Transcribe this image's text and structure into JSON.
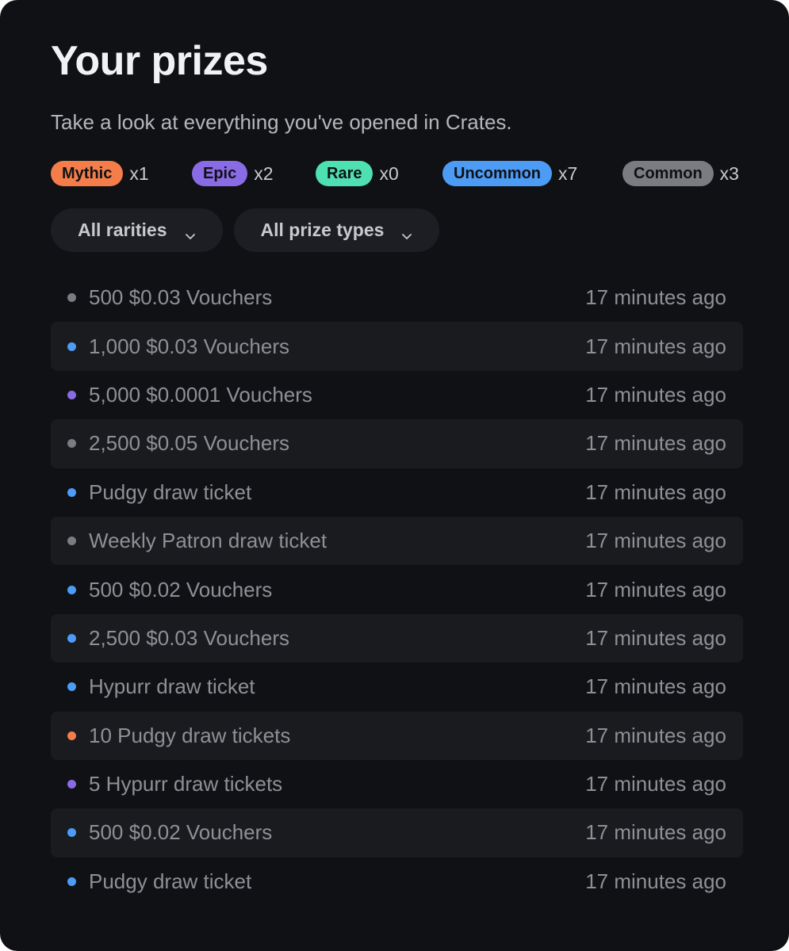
{
  "header": {
    "title": "Your prizes",
    "subtitle": "Take a look at everything you've opened in Crates."
  },
  "rarities": [
    {
      "label": "Mythic",
      "count": "x1",
      "color": "#f47d4a"
    },
    {
      "label": "Epic",
      "count": "x2",
      "color": "#8a6be6"
    },
    {
      "label": "Rare",
      "count": "x0",
      "color": "#4ee0b0"
    },
    {
      "label": "Uncommon",
      "count": "x7",
      "color": "#4c9bf5"
    },
    {
      "label": "Common",
      "count": "x3",
      "color": "#7a7c82"
    }
  ],
  "filters": {
    "rarity_label": "All rarities",
    "prize_type_label": "All prize types",
    "chevron_icon": "chevron-down-icon"
  },
  "prizes": [
    {
      "name": "500 $0.03 Vouchers",
      "time": "17 minutes ago",
      "rarity": "Common"
    },
    {
      "name": "1,000 $0.03 Vouchers",
      "time": "17 minutes ago",
      "rarity": "Uncommon"
    },
    {
      "name": "5,000 $0.0001 Vouchers",
      "time": "17 minutes ago",
      "rarity": "Epic"
    },
    {
      "name": "2,500 $0.05 Vouchers",
      "time": "17 minutes ago",
      "rarity": "Common"
    },
    {
      "name": "Pudgy draw ticket",
      "time": "17 minutes ago",
      "rarity": "Uncommon"
    },
    {
      "name": "Weekly Patron draw ticket",
      "time": "17 minutes ago",
      "rarity": "Common"
    },
    {
      "name": "500 $0.02 Vouchers",
      "time": "17 minutes ago",
      "rarity": "Uncommon"
    },
    {
      "name": "2,500 $0.03 Vouchers",
      "time": "17 minutes ago",
      "rarity": "Uncommon"
    },
    {
      "name": "Hypurr draw ticket",
      "time": "17 minutes ago",
      "rarity": "Uncommon"
    },
    {
      "name": "10 Pudgy draw tickets",
      "time": "17 minutes ago",
      "rarity": "Mythic"
    },
    {
      "name": "5 Hypurr draw tickets",
      "time": "17 minutes ago",
      "rarity": "Epic"
    },
    {
      "name": "500 $0.02 Vouchers",
      "time": "17 minutes ago",
      "rarity": "Uncommon"
    },
    {
      "name": "Pudgy draw ticket",
      "time": "17 minutes ago",
      "rarity": "Uncommon"
    }
  ]
}
